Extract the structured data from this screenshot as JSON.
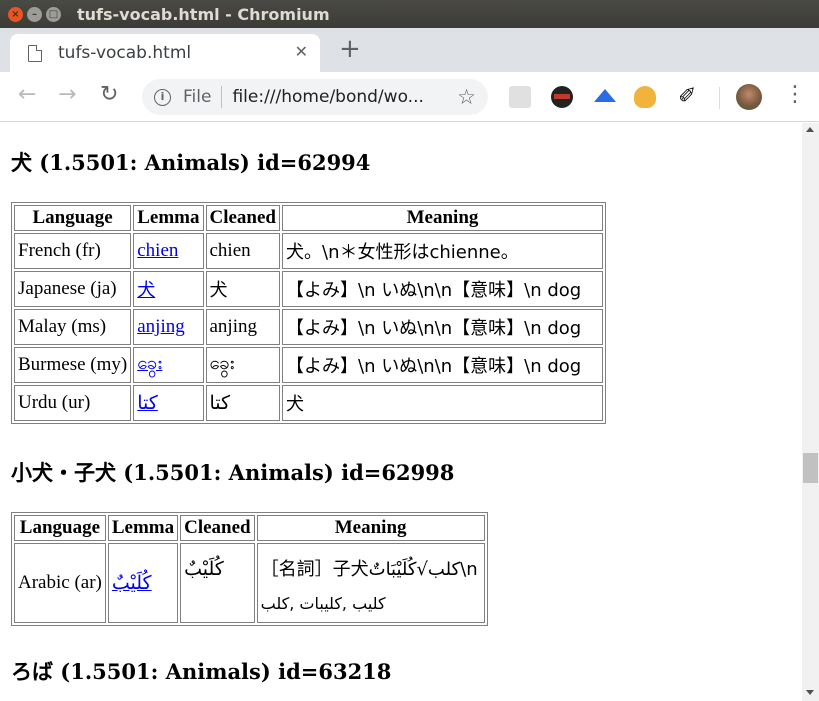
{
  "window": {
    "title": "tufs-vocab.html - Chromium"
  },
  "tab": {
    "title": "tufs-vocab.html",
    "close": "✕"
  },
  "toolbar": {
    "scheme": "File",
    "url": "file:///home/bond/wo..."
  },
  "icons": {
    "back": "back-arrow-icon",
    "forward": "forward-arrow-icon",
    "reload": "reload-icon",
    "star": "bookmark-star-icon",
    "menu": "kebab-menu-icon"
  },
  "sections": [
    {
      "heading_jp": "犬",
      "heading_rest": " (1.5501: Animals) id=62994",
      "headers": [
        "Language",
        "Lemma",
        "Cleaned",
        "Meaning"
      ],
      "rows": [
        [
          "French (fr)",
          "chien",
          "chien",
          "犬。\\n＊女性形はchienne。"
        ],
        [
          "Japanese (ja)",
          "犬",
          "犬",
          "【よみ】\\n いぬ\\n\\n【意味】\\n dog"
        ],
        [
          "Malay (ms)",
          "anjing",
          "anjing",
          "【よみ】\\n いぬ\\n\\n【意味】\\n dog"
        ],
        [
          "Burmese (my)",
          "ခွေး",
          "ခွေး",
          "【よみ】\\n いぬ\\n\\n【意味】\\n dog"
        ],
        [
          "Urdu (ur)",
          "کتا",
          "کتا",
          "犬"
        ]
      ]
    },
    {
      "heading_jp": "小犬・子犬",
      "heading_rest": " (1.5501: Animals) id=62998",
      "headers": [
        "Language",
        "Lemma",
        "Cleaned",
        "Meaning"
      ],
      "rows": [
        [
          "Arabic (ar)",
          "كُلَيْبٌ",
          "كُلَيْبٌ",
          "［名詞］子犬كلب√كُلَيْبَاتٌ\\n",
          "كليب ,كليبات ,كلب"
        ]
      ]
    },
    {
      "heading_jp": "ろば",
      "heading_rest": " (1.5501: Animals) id=63218"
    }
  ]
}
